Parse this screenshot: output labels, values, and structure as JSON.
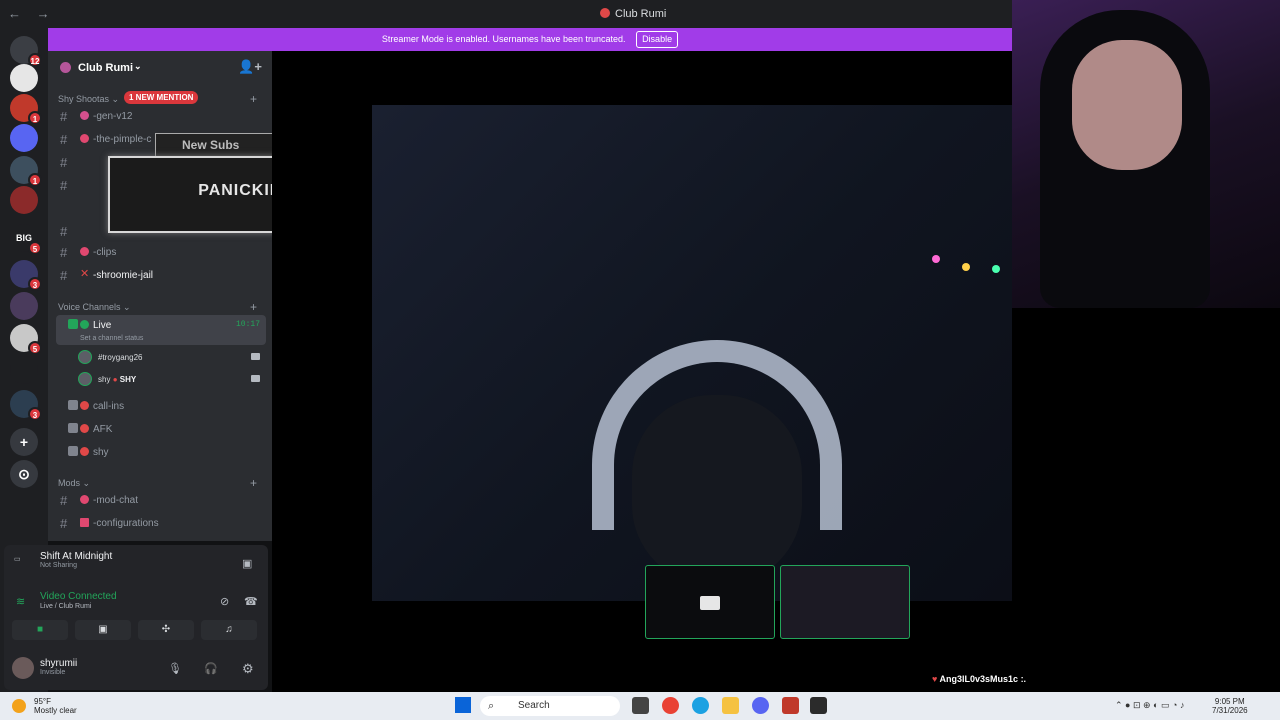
{
  "window": {
    "title": "Club Rumi",
    "nav": "← →"
  },
  "banner": {
    "text": "Streamer Mode is enabled. Usernames have been truncated.",
    "button": "Disable"
  },
  "servers": [
    {
      "label": "",
      "badge": "12"
    },
    {
      "label": "",
      "badge": ""
    },
    {
      "label": "",
      "badge": "1"
    },
    {
      "label": "",
      "badge": ""
    },
    {
      "label": "",
      "badge": "1"
    },
    {
      "label": "",
      "badge": ""
    },
    {
      "label": "BIG",
      "badge": "5"
    },
    {
      "label": "",
      "badge": "3"
    },
    {
      "label": "",
      "badge": ""
    },
    {
      "label": "",
      "badge": "5"
    },
    {
      "label": "",
      "badge": ""
    },
    {
      "label": "",
      "badge": "3"
    }
  ],
  "server": {
    "name": "Club Rumi"
  },
  "categories": {
    "shy": "Shy Shootas",
    "voice": "Voice Channels",
    "mods": "Mods"
  },
  "mention": "1 NEW MENTION",
  "channels": {
    "gen": "-gen-v12",
    "pimple": "-the-pimple-c",
    "clips": "-clips",
    "jail": "-shroomie-jail",
    "live": "Live",
    "live_time": "10:17",
    "live_status": "Set a channel status",
    "callins": "call-ins",
    "afk": "AFK",
    "shy": "shy",
    "modchat": "-mod-chat",
    "config": "-configurations"
  },
  "voice_members": [
    {
      "name": "#troygang26",
      "tag": ""
    },
    {
      "name": "shy",
      "tag": "SHY"
    }
  ],
  "overlay": {
    "text": "PANICKING",
    "tab": "New Subs"
  },
  "panel": {
    "activity": "Shift At Midnight",
    "activity_sub": "Not Sharing",
    "connection": "Video Connected",
    "connection_sub": "Live / Club Rumi",
    "user": "shyrumii",
    "user_status": "Invisible"
  },
  "chat": {
    "user": "Ang3lL0v3sMus1c",
    "msg": ":."
  },
  "taskbar": {
    "temp": "95°F",
    "weather": "Mostly clear",
    "search": "Search",
    "time": "9:05 PM",
    "date": "7/31/2026"
  },
  "colors": {
    "accent": "#a13ce8",
    "online": "#23a55a",
    "mention": "#da373c"
  }
}
